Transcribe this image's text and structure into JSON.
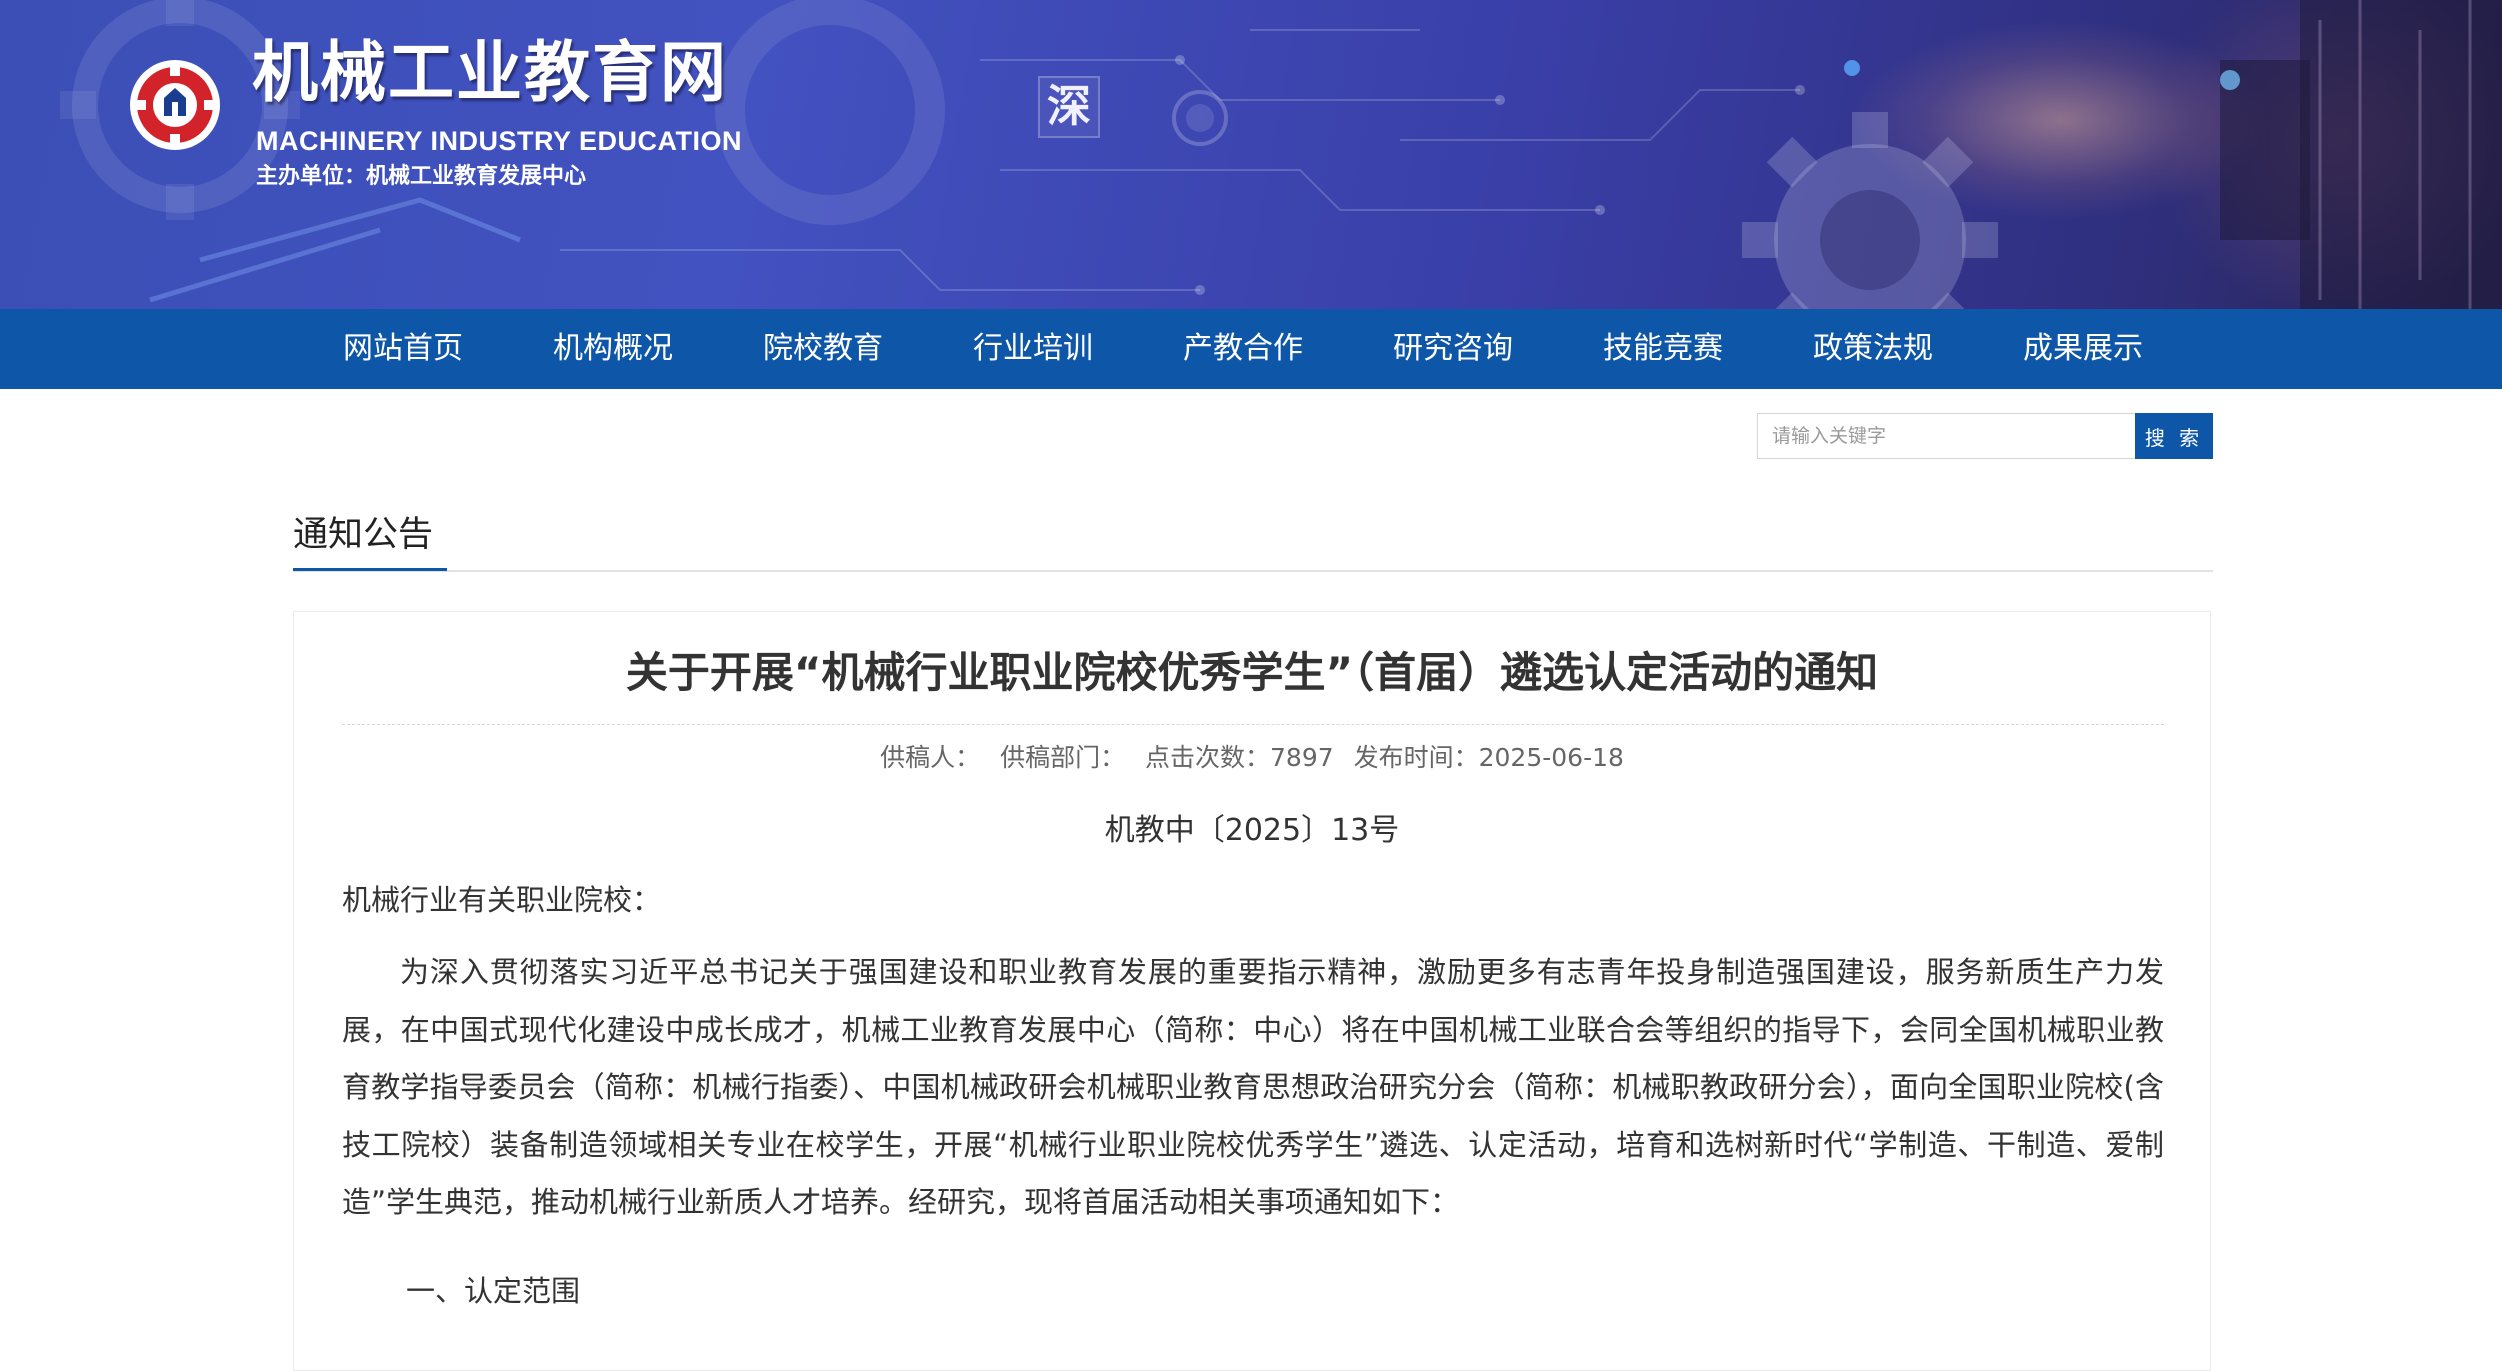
{
  "header": {
    "title": "机械工业教育网",
    "subtitle": "MACHINERY INDUSTRY EDUCATION",
    "host": "主办单位：机械工业教育发展中心",
    "banner_char": "深",
    "logo_icon": "gear-logo-icon"
  },
  "nav": {
    "items": [
      "网站首页",
      "机构概况",
      "院校教育",
      "行业培训",
      "产教合作",
      "研究咨询",
      "技能竞赛",
      "政策法规",
      "成果展示"
    ]
  },
  "search": {
    "placeholder": "请输入关键字",
    "button_label": "搜 索"
  },
  "section": {
    "title": "通知公告"
  },
  "article": {
    "title": "关于开展“机械行业职业院校优秀学生”（首届）遴选认定活动的通知",
    "meta": {
      "author": "供稿人：",
      "department": "供稿部门：",
      "clicks": "点击次数：7897",
      "date": "发布时间：2025-06-18"
    },
    "doc_number": "机教中〔2025〕13号",
    "salutation": "机械行业有关职业院校：",
    "paragraph": "为深入贯彻落实习近平总书记关于强国建设和职业教育发展的重要指示精神，激励更多有志青年投身制造强国建设，服务新质生产力发展，在中国式现代化建设中成长成才，机械工业教育发展中心（简称：中心）将在中国机械工业联合会等组织的指导下，会同全国机械职业教育教学指导委员会（简称：机械行指委）、中国机械政研会机械职业教育思想政治研究分会（简称：机械职教政研分会），面向全国职业院校(含技工院校）装备制造领域相关专业在校学生，开展“机械行业职业院校优秀学生”遴选、认定活动，培育和选树新时代“学制造、干制造、爱制造”学生典范，推动机械行业新质人才培养。经研究，现将首届活动相关事项通知如下：",
    "section1": "一、认定范围"
  },
  "colors": {
    "nav_bg": "#0e56a8",
    "banner_primary": "#3b4fb6",
    "accent": "#0e56a8"
  }
}
